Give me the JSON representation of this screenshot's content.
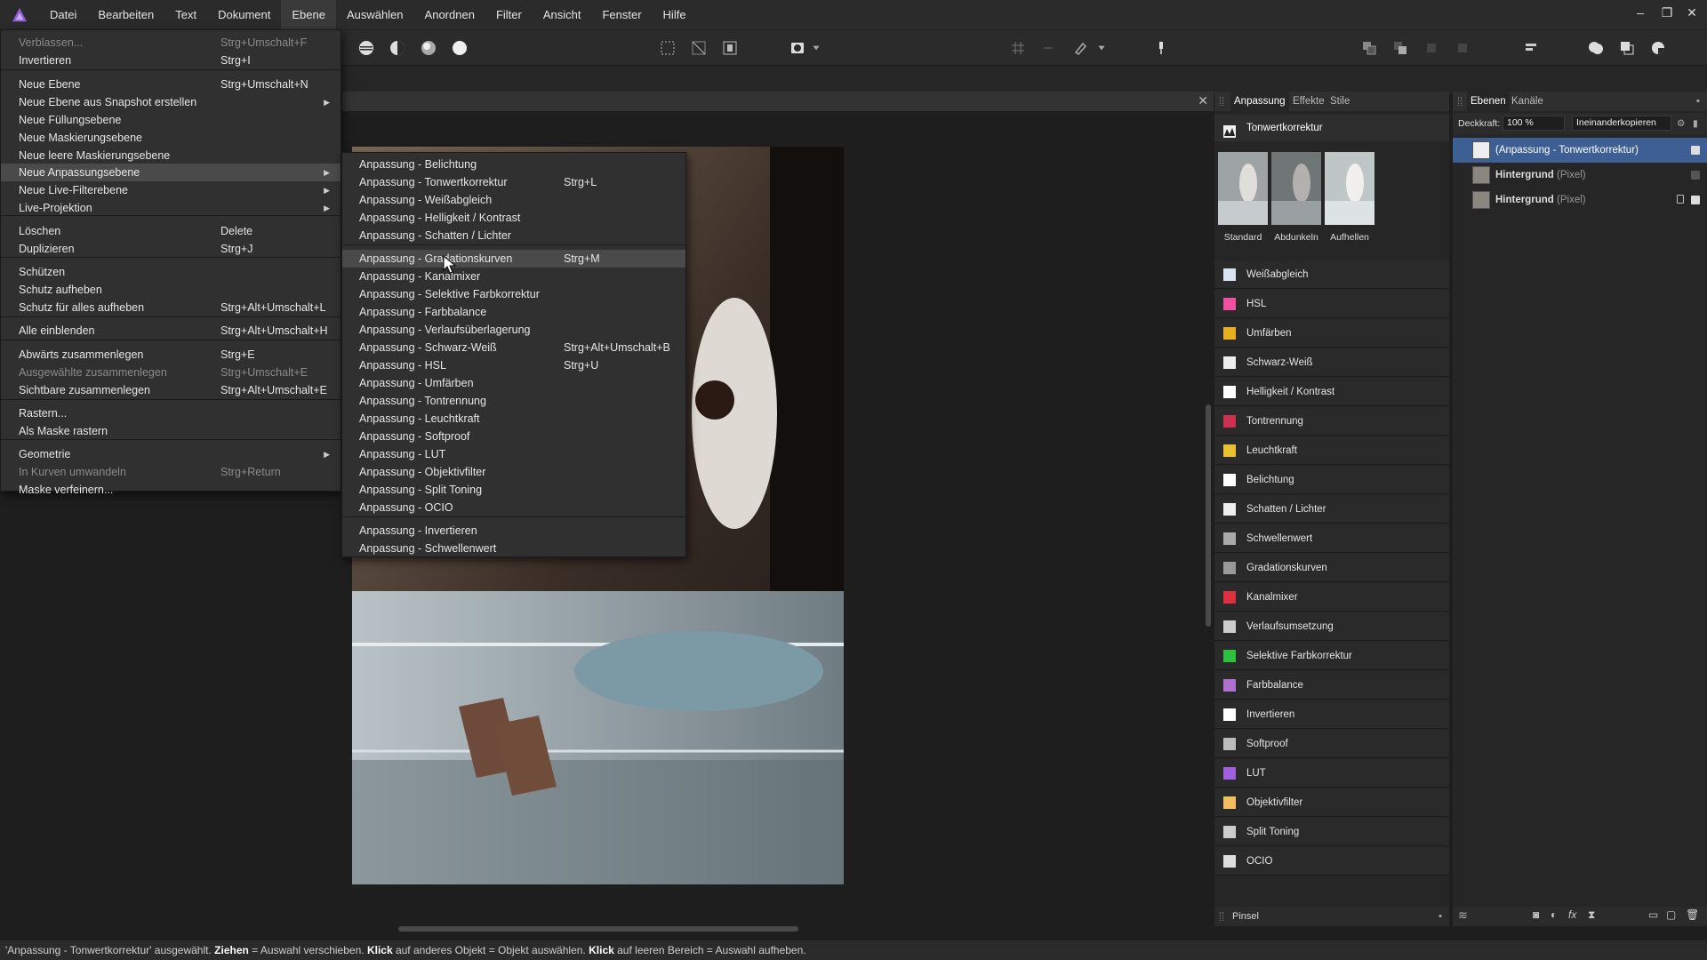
{
  "menubar": {
    "items": [
      "Datei",
      "Bearbeiten",
      "Text",
      "Dokument",
      "Ebene",
      "Auswählen",
      "Anordnen",
      "Filter",
      "Ansicht",
      "Fenster",
      "Hilfe"
    ],
    "active_index": 4
  },
  "ebene_menu": {
    "items": [
      {
        "label": "Verblassen...",
        "shortcut": "Strg+Umschalt+F",
        "disabled": true
      },
      {
        "label": "Invertieren",
        "shortcut": "Strg+I"
      },
      {
        "label": "Neue Ebene",
        "shortcut": "Strg+Umschalt+N"
      },
      {
        "label": "Neue Ebene aus Snapshot erstellen",
        "shortcut": "",
        "submenu": true
      },
      {
        "label": "Neue Füllungsebene",
        "shortcut": ""
      },
      {
        "label": "Neue Maskierungsebene",
        "shortcut": ""
      },
      {
        "label": "Neue leere Maskierungsebene",
        "shortcut": ""
      },
      {
        "label": "Neue Anpassungsebene",
        "shortcut": "",
        "submenu": true,
        "highlighted": true
      },
      {
        "label": "Neue Live-Filterebene",
        "shortcut": "",
        "submenu": true
      },
      {
        "label": "Live-Projektion",
        "shortcut": "",
        "submenu": true
      },
      {
        "label": "Löschen",
        "shortcut": "Delete"
      },
      {
        "label": "Duplizieren",
        "shortcut": "Strg+J"
      },
      {
        "label": "Schützen",
        "shortcut": ""
      },
      {
        "label": "Schutz aufheben",
        "shortcut": ""
      },
      {
        "label": "Schutz für alles aufheben",
        "shortcut": "Strg+Alt+Umschalt+L"
      },
      {
        "label": "Alle einblenden",
        "shortcut": "Strg+Alt+Umschalt+H"
      },
      {
        "label": "Abwärts zusammenlegen",
        "shortcut": "Strg+E"
      },
      {
        "label": "Ausgewählte zusammenlegen",
        "shortcut": "Strg+Umschalt+E",
        "disabled": true
      },
      {
        "label": "Sichtbare zusammenlegen",
        "shortcut": "Strg+Alt+Umschalt+E"
      },
      {
        "label": "Rastern...",
        "shortcut": ""
      },
      {
        "label": "Als Maske rastern",
        "shortcut": ""
      },
      {
        "label": "Geometrie",
        "shortcut": "",
        "submenu": true
      },
      {
        "label": "In Kurven umwandeln",
        "shortcut": "Strg+Return",
        "disabled": true
      },
      {
        "label": "Maske verfeinern...",
        "shortcut": ""
      }
    ]
  },
  "adjustment_submenu": {
    "items": [
      {
        "label": "Anpassung - Belichtung",
        "shortcut": ""
      },
      {
        "label": "Anpassung - Tonwertkorrektur",
        "shortcut": "Strg+L"
      },
      {
        "label": "Anpassung - Weißabgleich",
        "shortcut": ""
      },
      {
        "label": "Anpassung - Helligkeit / Kontrast",
        "shortcut": ""
      },
      {
        "label": "Anpassung - Schatten / Lichter",
        "shortcut": ""
      },
      {
        "label": "Anpassung - Gradationskurven",
        "shortcut": "Strg+M",
        "highlighted": true
      },
      {
        "label": "Anpassung - Kanalmixer",
        "shortcut": ""
      },
      {
        "label": "Anpassung - Selektive Farbkorrektur",
        "shortcut": ""
      },
      {
        "label": "Anpassung - Farbbalance",
        "shortcut": ""
      },
      {
        "label": "Anpassung - Verlaufsüberlagerung",
        "shortcut": ""
      },
      {
        "label": "Anpassung - Schwarz-Weiß",
        "shortcut": "Strg+Alt+Umschalt+B"
      },
      {
        "label": "Anpassung - HSL",
        "shortcut": "Strg+U"
      },
      {
        "label": "Anpassung - Umfärben",
        "shortcut": ""
      },
      {
        "label": "Anpassung - Tontrennung",
        "shortcut": ""
      },
      {
        "label": "Anpassung - Leuchtkraft",
        "shortcut": ""
      },
      {
        "label": "Anpassung - Softproof",
        "shortcut": ""
      },
      {
        "label": "Anpassung - LUT",
        "shortcut": ""
      },
      {
        "label": "Anpassung - Objektivfilter",
        "shortcut": ""
      },
      {
        "label": "Anpassung - Split Toning",
        "shortcut": ""
      },
      {
        "label": "Anpassung - OCIO",
        "shortcut": ""
      },
      {
        "label": "Anpassung - Invertieren",
        "shortcut": ""
      },
      {
        "label": "Anpassung - Schwellenwert",
        "shortcut": ""
      }
    ]
  },
  "adjustment_panel": {
    "tabs": [
      "Anpassung",
      "Effekte",
      "Stile"
    ],
    "selected": "Tonwertkorrektur",
    "presets": [
      "Standard",
      "Abdunkeln",
      "Aufhellen"
    ],
    "items": [
      {
        "label": "Weißabgleich",
        "icon": "white-balance-icon"
      },
      {
        "label": "HSL",
        "icon": "hsl-icon"
      },
      {
        "label": "Umfärben",
        "icon": "recolor-icon"
      },
      {
        "label": "Schwarz-Weiß",
        "icon": "black-white-icon"
      },
      {
        "label": "Helligkeit / Kontrast",
        "icon": "brightness-contrast-icon"
      },
      {
        "label": "Tontrennung",
        "icon": "posterize-icon"
      },
      {
        "label": "Leuchtkraft",
        "icon": "vibrance-icon"
      },
      {
        "label": "Belichtung",
        "icon": "exposure-icon"
      },
      {
        "label": "Schatten / Lichter",
        "icon": "shadows-highlights-icon"
      },
      {
        "label": "Schwellenwert",
        "icon": "threshold-icon"
      },
      {
        "label": "Gradationskurven",
        "icon": "curves-icon"
      },
      {
        "label": "Kanalmixer",
        "icon": "channel-mixer-icon"
      },
      {
        "label": "Verlaufsumsetzung",
        "icon": "gradient-map-icon"
      },
      {
        "label": "Selektive Farbkorrektur",
        "icon": "selective-color-icon"
      },
      {
        "label": "Farbbalance",
        "icon": "color-balance-icon"
      },
      {
        "label": "Invertieren",
        "icon": "invert-icon"
      },
      {
        "label": "Softproof",
        "icon": "soft-proof-icon"
      },
      {
        "label": "LUT",
        "icon": "lut-icon"
      },
      {
        "label": "Objektivfilter",
        "icon": "lens-filter-icon"
      },
      {
        "label": "Split Toning",
        "icon": "split-toning-icon"
      },
      {
        "label": "OCIO",
        "icon": "ocio-icon"
      }
    ],
    "footer_label": "Pinsel"
  },
  "layers_panel": {
    "tabs": [
      "Ebenen",
      "Kanäle"
    ],
    "opacity_label": "Deckkraft:",
    "opacity_value": "100 %",
    "blend_mode": "Ineinanderkopieren",
    "layers": [
      {
        "name": "(Anpassung - Tonwertkorrektur)",
        "suffix": "",
        "selected": true
      },
      {
        "name": "Hintergrund",
        "suffix": " (Pixel)",
        "selected": false
      },
      {
        "name": "Hintergrund",
        "suffix": " (Pixel)",
        "selected": false,
        "locked": true
      }
    ]
  },
  "status": {
    "selected_text": "'Anpassung - Tonwertkorrektur' ausgewählt.",
    "drag_bold": "Ziehen",
    "drag_text": " = Auswahl verschieben.",
    "click_bold": "Klick",
    "click_text": " auf anderes Objekt = Objekt auswählen.",
    "click2_bold": "Klick",
    "click2_text": " auf leeren Bereich = Auswahl aufheben."
  },
  "colors": {
    "accent": "#3d5f93",
    "menu_bg": "#303030",
    "logo": "#8f5cd6"
  }
}
